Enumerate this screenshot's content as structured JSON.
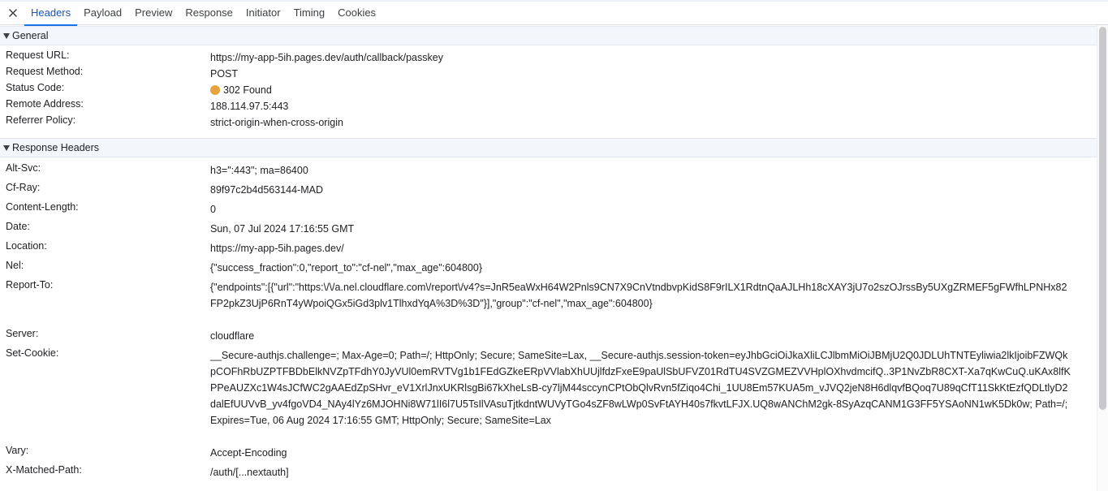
{
  "tabs": [
    "Headers",
    "Payload",
    "Preview",
    "Response",
    "Initiator",
    "Timing",
    "Cookies"
  ],
  "active_tab": "Headers",
  "sections": {
    "general": {
      "title": "General",
      "rows": [
        {
          "key": "Request URL:",
          "value": "https://my-app-5ih.pages.dev/auth/callback/passkey"
        },
        {
          "key": "Request Method:",
          "value": "POST"
        },
        {
          "key": "Status Code:",
          "value": "302 Found"
        },
        {
          "key": "Remote Address:",
          "value": "188.114.97.5:443"
        },
        {
          "key": "Referrer Policy:",
          "value": "strict-origin-when-cross-origin"
        }
      ]
    },
    "response": {
      "title": "Response Headers",
      "rows": [
        {
          "key": "Alt-Svc:",
          "value": "h3=\":443\"; ma=86400"
        },
        {
          "key": "Cf-Ray:",
          "value": "89f97c2b4d563144-MAD"
        },
        {
          "key": "Content-Length:",
          "value": "0"
        },
        {
          "key": "Date:",
          "value": "Sun, 07 Jul 2024 17:16:55 GMT"
        },
        {
          "key": "Location:",
          "value": "https://my-app-5ih.pages.dev/"
        },
        {
          "key": "Nel:",
          "value": "{\"success_fraction\":0,\"report_to\":\"cf-nel\",\"max_age\":604800}"
        },
        {
          "key": "Report-To:",
          "value": "{\"endpoints\":[{\"url\":\"https:\\/\\/a.nel.cloudflare.com\\/report\\/v4?s=JnR5eaWxH64W2Pnls9CN7X9CnVtndbvpKidS8F9rILX1RdtnQaAJLHh18cXAY3jU7o2szOJrssBy5UXgZRMEF5gFWfhLPNHx82FP2pkZ3UjP6RnT4yWpoiQGx5iGd3plv1TlhxdYqA%3D%3D\"}],\"group\":\"cf-nel\",\"max_age\":604800}"
        },
        {
          "key": "Server:",
          "value": "cloudflare"
        },
        {
          "key": "Set-Cookie:",
          "value": "__Secure-authjs.challenge=; Max-Age=0; Path=/; HttpOnly; Secure; SameSite=Lax, __Secure-authjs.session-token=eyJhbGciOiJkaXliLCJlbmMiOiJBMjU2Q0JDLUhTNTEyliwia2lkIjoibFZWQkpCOFhRbUZPTFBDbElkNVZpTFdhY0JyVUl0emRVTVg1b1FEdGZkeERpVVlabXhUUjlfdzFxeE9paUlSbUFVZ01RdTU4SVZGMEZVVHplOXhvdmcifQ..3P1NvZbR8CXT-Xa7qKwCuQ.uKAx8lfKPPeAUZXc1W4sJCfWC2gAAEdZpSHvr_eV1XrlJnxUKRlsgBi67kXheLsB-cy7ljM44sccynCPtObQlvRvn5fZiqo4Chi_1UU8Em57KUA5m_vJVQ2jeN8H6dlqvfBQoq7U89qCfT11SkKtEzfQDLtlyD2dalEfUUVvB_yv4fgoVD4_NAy4lYz6MJOHNi8W71lI6l7U5TsIlVAsuTjtkdntWUVyTGo4sZF8wLWp0SvFtAYH40s7fkvtLFJX.UQ8wANChM2gk-8SyAzqCANM1G3FF5YSAoNN1wK5Dk0w; Path=/; Expires=Tue, 06 Aug 2024 17:16:55 GMT; HttpOnly; Secure; SameSite=Lax"
        },
        {
          "key": "Vary:",
          "value": "Accept-Encoding"
        },
        {
          "key": "X-Matched-Path:",
          "value": "/auth/[...nextauth]"
        }
      ]
    }
  },
  "colors": {
    "status_dot": "#e8a33d",
    "accent": "#1a73e8"
  },
  "icons": {
    "close": "close-icon",
    "section_toggle": "triangle-down-icon"
  }
}
